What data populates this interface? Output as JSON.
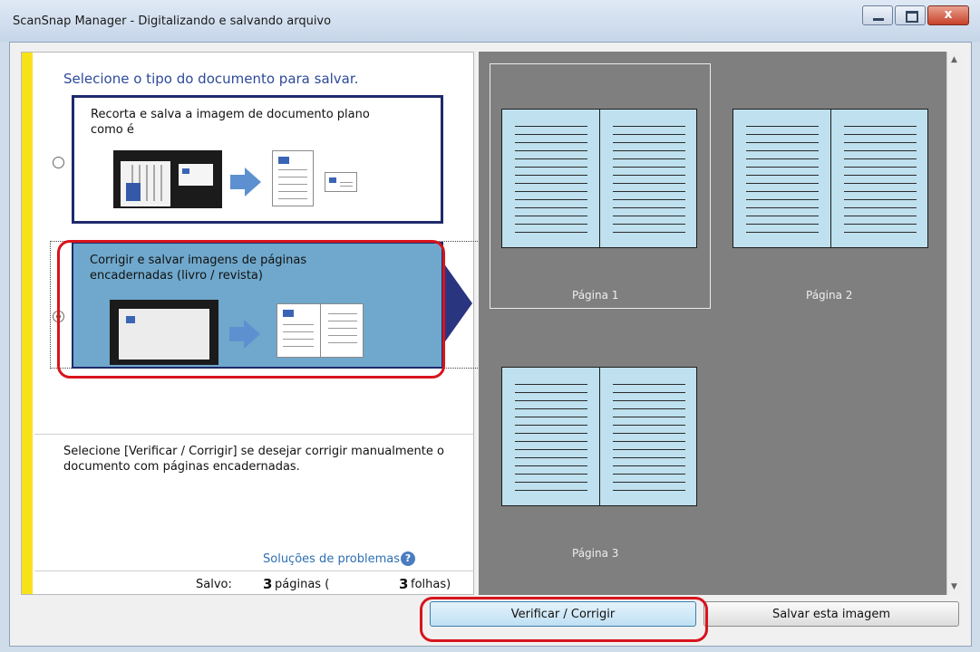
{
  "window": {
    "title": "ScanSnap Manager - Digitalizando e salvando arquivo",
    "close_label": "x"
  },
  "left": {
    "prompt": "Selecione o tipo do documento para salvar.",
    "option1_label": "Recorta e salva a imagem de documento plano como é",
    "option2_label": "Corrigir e salvar imagens de páginas encadernadas (livro / revista)",
    "option2_selected": true,
    "help_text": "Selecione [Verificar / Corrigir] se desejar corrigir manualmente o documento com páginas encadernadas.",
    "troubleshooting": "Soluções de problemas",
    "help_icon": "?",
    "saved_label": "Salvo:",
    "saved_pages_count": "3",
    "saved_pages_text": "páginas (",
    "saved_sheets_count": "3",
    "saved_sheets_text": "folhas)"
  },
  "preview": {
    "pages": [
      "Página 1",
      "Página 2",
      "Página 3"
    ]
  },
  "buttons": {
    "verify": "Verificar / Corrigir",
    "save": "Salvar esta imagem"
  }
}
